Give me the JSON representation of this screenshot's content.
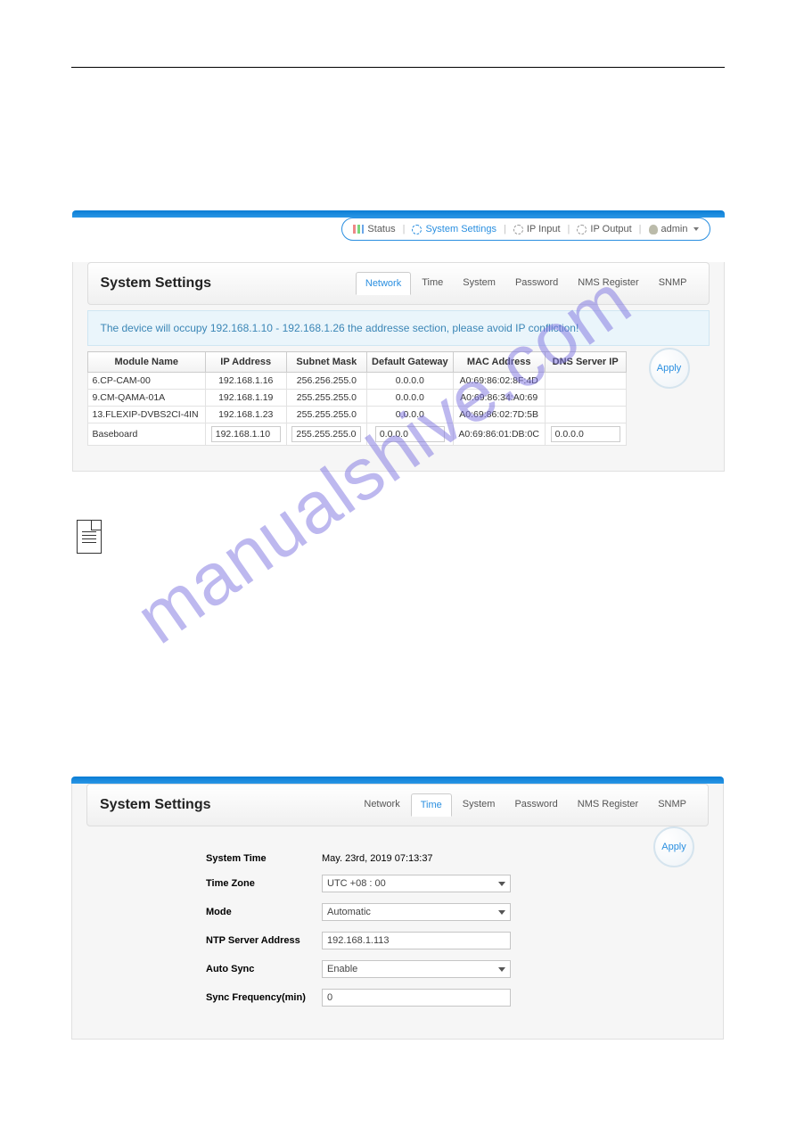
{
  "watermark": "manualshive.com",
  "nav": {
    "status": "Status",
    "system_settings": "System Settings",
    "ip_input": "IP Input",
    "ip_output": "IP Output",
    "admin": "admin"
  },
  "panel1": {
    "title": "System Settings",
    "tabs": [
      "Network",
      "Time",
      "System",
      "Password",
      "NMS Register",
      "SNMP"
    ],
    "active_tab": "Network",
    "alert": "The device will occupy 192.168.1.10 - 192.168.1.26 the addresse section, please avoid IP confliction!",
    "headers": [
      "Module Name",
      "IP Address",
      "Subnet Mask",
      "Default Gateway",
      "MAC Address",
      "DNS Server IP"
    ],
    "rows": [
      {
        "module": "6.CP-CAM-00",
        "ip": "192.168.1.16",
        "mask": "256.256.255.0",
        "gw": "0.0.0.0",
        "mac": "A0:69:86:02:8F:4D",
        "dns": ""
      },
      {
        "module": "9.CM-QAMA-01A",
        "ip": "192.168.1.19",
        "mask": "255.255.255.0",
        "gw": "0.0.0.0",
        "mac": "A0:69:86:34:A0:69",
        "dns": ""
      },
      {
        "module": "13.FLEXIP-DVBS2CI-4IN",
        "ip": "192.168.1.23",
        "mask": "255.255.255.0",
        "gw": "0.0.0.0",
        "mac": "A0:69:86:02:7D:5B",
        "dns": ""
      }
    ],
    "baseboard": {
      "module": "Baseboard",
      "ip": "192.168.1.10",
      "mask": "255.255.255.0",
      "gw": "0.0.0.0",
      "mac": "A0:69:86:01:DB:0C",
      "dns": "0.0.0.0"
    },
    "apply": "Apply"
  },
  "panel2": {
    "title": "System Settings",
    "tabs": [
      "Network",
      "Time",
      "System",
      "Password",
      "NMS Register",
      "SNMP"
    ],
    "active_tab": "Time",
    "fields": {
      "system_time_label": "System Time",
      "system_time_value": "May. 23rd, 2019 07:13:37",
      "time_zone_label": "Time Zone",
      "time_zone_value": "UTC +08 : 00",
      "mode_label": "Mode",
      "mode_value": "Automatic",
      "ntp_label": "NTP Server Address",
      "ntp_value": "192.168.1.113",
      "auto_sync_label": "Auto Sync",
      "auto_sync_value": "Enable",
      "sync_freq_label": "Sync Frequency(min)",
      "sync_freq_value": "0"
    },
    "apply": "Apply"
  }
}
